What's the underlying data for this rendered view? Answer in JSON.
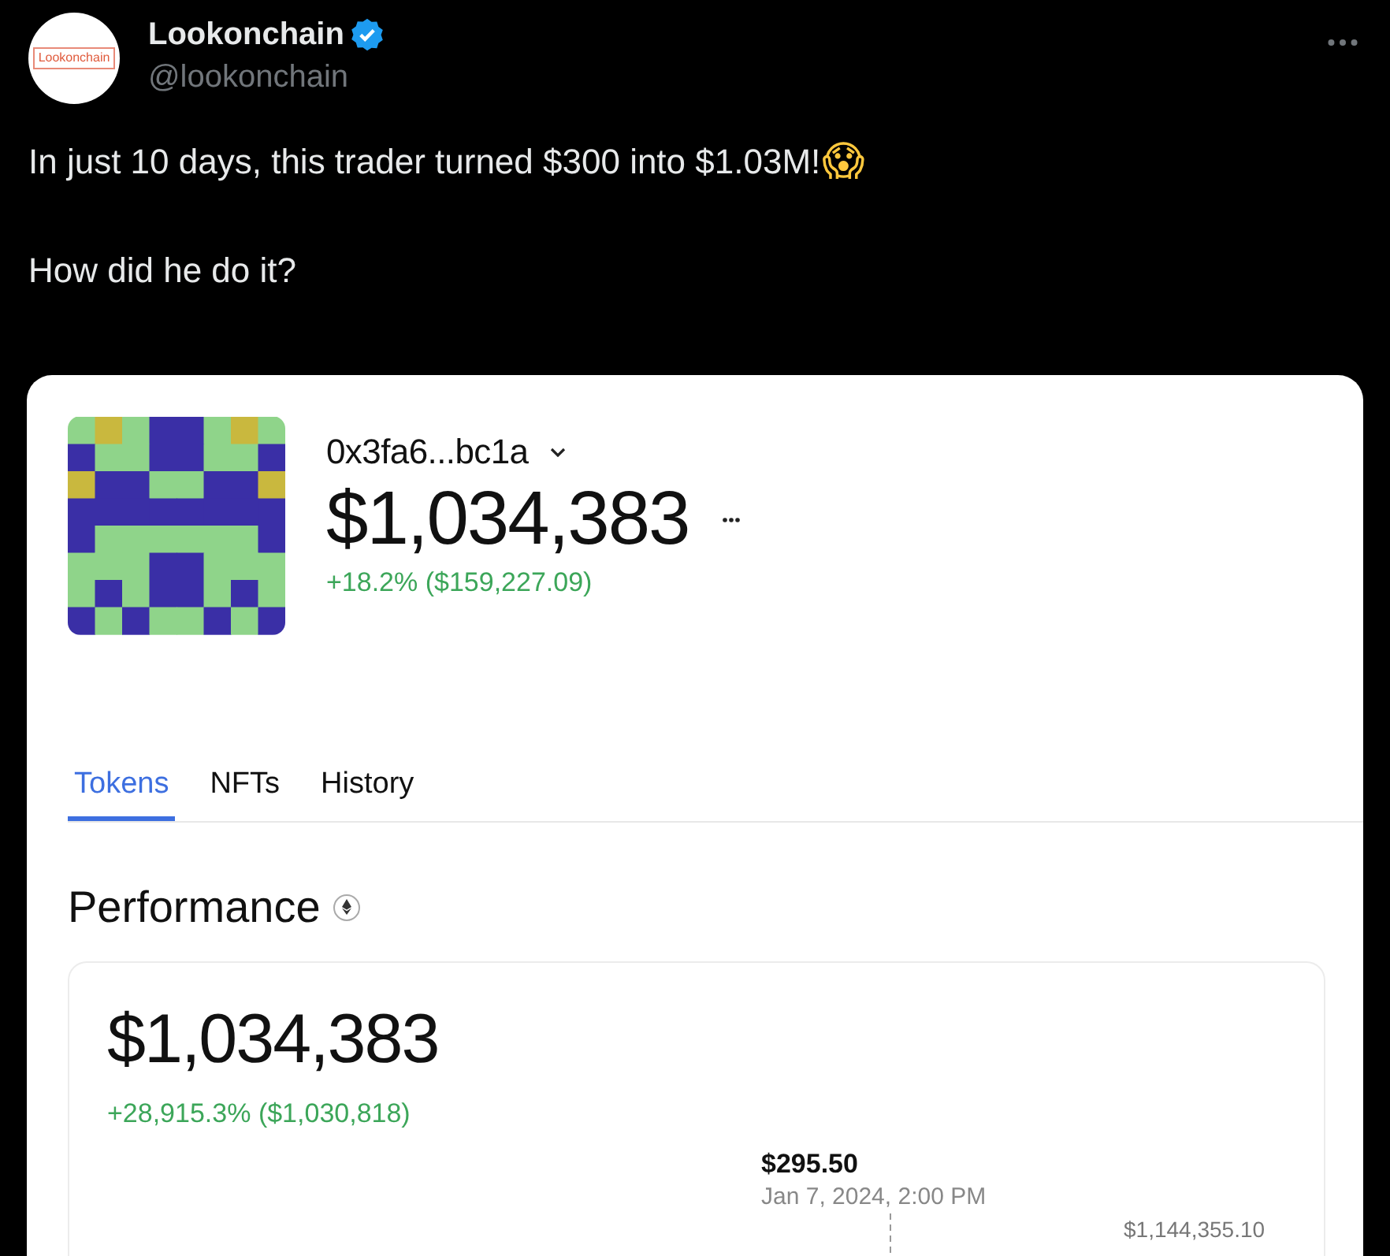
{
  "post": {
    "author": {
      "name": "Lookonchain",
      "handle": "@lookonchain",
      "verified": true,
      "avatar_text": "Lookonchain"
    },
    "paragraphs": [
      {
        "text": "In just 10 days, this trader turned $300 into $1.03M!",
        "emoji": "😱"
      },
      {
        "text": "How did he do it?"
      }
    ]
  },
  "wallet": {
    "address": "0x3fa6...bc1a",
    "balance": "$1,034,383",
    "change": "+18.2% ($159,227.09)"
  },
  "tabs": [
    {
      "label": "Tokens",
      "selected": true
    },
    {
      "label": "NFTs",
      "selected": false
    },
    {
      "label": "History",
      "selected": false
    }
  ],
  "performance": {
    "title": "Performance",
    "value": "$1,034,383",
    "change": "+28,915.3% ($1,030,818)",
    "tooltip": {
      "price": "$295.50",
      "date": "Jan 7, 2024, 2:00 PM"
    },
    "max_label": "$1,144,355.10"
  }
}
